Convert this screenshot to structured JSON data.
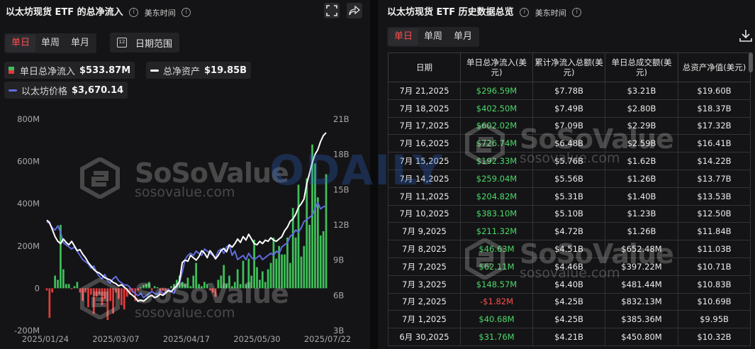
{
  "left_panel": {
    "title": "以太坊现货 ETF 的总净流入",
    "info": "i",
    "timezone": "美东时间",
    "tabs": [
      "单日",
      "单周",
      "单月"
    ],
    "active_tab": "单日",
    "date_range_label": "日期范围",
    "calendar_num": "12",
    "legend": {
      "daily_label": "单日总净流入",
      "daily_value": "$533.87M",
      "assets_label": "总净资产",
      "assets_value": "$19.85B",
      "price_label": "以太坊价格",
      "price_value": "$3,670.14"
    },
    "watermark": {
      "brand": "SoSoValue",
      "url": "sosovalue.com"
    }
  },
  "chart_data": {
    "type": "bar+line",
    "left_axis_ticks": [
      "800M",
      "600M",
      "400M",
      "200M",
      "0",
      "-200M"
    ],
    "right_axis_ticks": [
      "21B",
      "18B",
      "15B",
      "12B",
      "9B",
      "6B",
      "3B"
    ],
    "x_ticks": [
      "2025/01/24",
      "2025/03/07",
      "2025/04/17",
      "2025/05/30",
      "2025/07/22"
    ],
    "ylim": [
      -200,
      800
    ],
    "ylim_right": [
      3,
      21
    ],
    "colors": {
      "positive": "#3fbf5a",
      "negative": "#e23b3b",
      "assets_line": "#ffffff",
      "price_line": "#5f6ce0"
    },
    "daily_net_inflow_M": [
      -10,
      -140,
      -20,
      60,
      40,
      300,
      90,
      20,
      20,
      -5,
      10,
      30,
      -20,
      -60,
      -20,
      -90,
      -30,
      -120,
      -40,
      -30,
      -80,
      -50,
      -150,
      -60,
      -120,
      -20,
      -50,
      -80,
      -100,
      -40,
      -30,
      -20,
      -60,
      -10,
      5,
      15,
      20,
      30,
      -10,
      10,
      5,
      -30,
      -10,
      -20,
      -5,
      10,
      20,
      40,
      60,
      30,
      20,
      50,
      10,
      60,
      120,
      20,
      10,
      30,
      20,
      -10,
      -20,
      -40,
      40,
      60,
      110,
      20,
      60,
      10,
      30,
      90,
      20,
      130,
      20,
      140,
      60,
      230,
      100,
      40,
      80,
      30,
      90,
      120,
      240,
      140,
      200,
      160,
      160,
      240,
      120,
      380,
      240,
      490,
      150,
      200,
      520,
      300,
      680,
      590,
      430,
      250,
      270,
      540
    ],
    "total_net_assets_B": [
      12.4,
      12.2,
      11.6,
      11.0,
      10.6,
      10.4,
      10.8,
      10.5,
      10.3,
      10.6,
      10.2,
      9.8,
      9.9,
      9.5,
      9.2,
      8.8,
      8.5,
      8.2,
      8.0,
      7.9,
      7.7,
      7.5,
      7.4,
      7.3,
      7.1,
      7.0,
      6.8,
      6.9,
      6.7,
      6.5,
      6.2,
      6.0,
      5.8,
      5.5,
      5.6,
      5.5,
      5.7,
      5.9,
      6.0,
      5.8,
      5.9,
      6.1,
      6.0,
      6.2,
      6.4,
      6.3,
      6.6,
      6.8,
      7.2,
      8.8,
      9.0,
      8.9,
      9.4,
      9.2,
      9.0,
      9.3,
      9.8,
      9.6,
      9.2,
      9.8,
      9.5,
      9.1,
      9.4,
      9.8,
      10.0,
      9.7,
      10.3,
      10.1,
      10.4,
      10.8,
      10.5,
      11.0,
      10.7,
      11.2,
      10.8,
      10.4,
      10.3,
      10.6,
      10.4,
      10.7,
      10.6,
      10.9,
      10.7,
      10.6,
      10.8,
      11.0,
      11.5,
      11.8,
      12.3,
      12.5,
      12.9,
      13.5,
      13.8,
      14.2,
      15.5,
      16.4,
      17.3,
      18.0,
      18.4,
      19.1,
      19.6,
      19.85
    ],
    "eth_price_usd": [
      3300,
      3250,
      3150,
      3100,
      3200,
      3050,
      2800,
      2750,
      2700,
      2650,
      2700,
      2600,
      2500,
      2400,
      2350,
      2300,
      2200,
      2250,
      2100,
      2000,
      1950,
      2050,
      1900,
      1850,
      1950,
      2000,
      1900,
      1850,
      1800,
      1800,
      1750,
      1650,
      1600,
      1550,
      1600,
      1500,
      1550,
      1600,
      1650,
      1600,
      1580,
      1650,
      1600,
      1620,
      1700,
      1650,
      1600,
      1800,
      1850,
      2100,
      2400,
      2500,
      2550,
      2500,
      2600,
      2550,
      2500,
      2650,
      2600,
      2550,
      2500,
      2450,
      2600,
      2650,
      2550,
      2700,
      2750,
      2500,
      2600,
      2400,
      2450,
      2500,
      2400,
      2550,
      2450,
      2400,
      2450,
      2500,
      2400,
      2450,
      2500,
      2550,
      2500,
      2600,
      2550,
      2700,
      2750,
      2800,
      2950,
      3000,
      3100,
      3050,
      3150,
      3300,
      3350,
      3400,
      3450,
      3600,
      3750,
      3600,
      3650,
      3670
    ]
  },
  "right_panel": {
    "title": "以太坊现货 ETF 历史数据总览",
    "info": "i",
    "timezone": "美东时间",
    "tabs": [
      "单日",
      "单周",
      "单月"
    ],
    "active_tab": "单日",
    "columns": [
      "日期",
      "单日总净流入(美元)",
      "累计净流入总额(美元)",
      "单日总成交额(美元)",
      "总资产净值(美元)"
    ],
    "rows": [
      [
        "7月 21,2025",
        "$296.59M",
        "$7.78B",
        "$3.21B",
        "$19.60B"
      ],
      [
        "7月 18,2025",
        "$402.50M",
        "$7.49B",
        "$2.80B",
        "$18.37B"
      ],
      [
        "7月 17,2025",
        "$602.02M",
        "$7.09B",
        "$2.29B",
        "$17.32B"
      ],
      [
        "7月 16,2025",
        "$726.74M",
        "$6.48B",
        "$2.59B",
        "$16.41B"
      ],
      [
        "7月 15,2025",
        "$192.33M",
        "$5.76B",
        "$1.62B",
        "$14.22B"
      ],
      [
        "7月 14,2025",
        "$259.04M",
        "$5.56B",
        "$1.26B",
        "$13.77B"
      ],
      [
        "7月 11,2025",
        "$204.82M",
        "$5.31B",
        "$1.40B",
        "$13.53B"
      ],
      [
        "7月 10,2025",
        "$383.10M",
        "$5.10B",
        "$1.23B",
        "$12.50B"
      ],
      [
        "7月 9,2025",
        "$211.32M",
        "$4.72B",
        "$1.26B",
        "$11.84B"
      ],
      [
        "7月 8,2025",
        "$46.63M",
        "$4.51B",
        "$652.48M",
        "$11.03B"
      ],
      [
        "7月 7,2025",
        "$62.11M",
        "$4.46B",
        "$397.22M",
        "$10.71B"
      ],
      [
        "7月 3,2025",
        "$148.57M",
        "$4.40B",
        "$481.44M",
        "$10.83B"
      ],
      [
        "7月 2,2025",
        "-$1.82M",
        "$4.25B",
        "$832.13M",
        "$10.69B"
      ],
      [
        "7月 1,2025",
        "$40.68M",
        "$4.25B",
        "$385.36M",
        "$9.95B"
      ],
      [
        "6月 30,2025",
        "$31.76M",
        "$4.21B",
        "$450.80M",
        "$10.32B"
      ]
    ],
    "watermark": {
      "brand": "SoSoValue",
      "url": "sosovalue.com"
    }
  },
  "overlay_watermark": "ODAILY"
}
